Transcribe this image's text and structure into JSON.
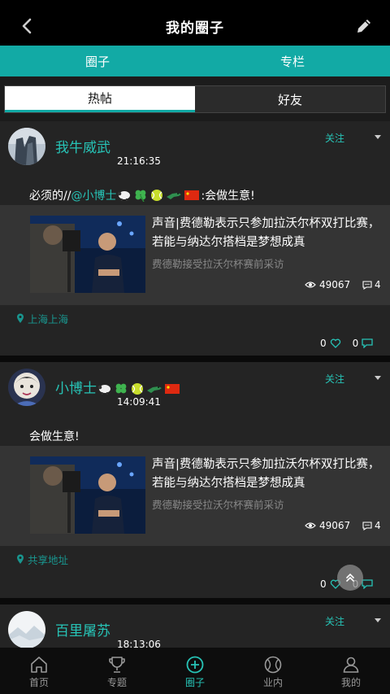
{
  "header": {
    "title": "我的圈子"
  },
  "tabs": [
    {
      "label": "圈子"
    },
    {
      "label": "专栏"
    }
  ],
  "subtabs": [
    {
      "label": "热帖",
      "active": true
    },
    {
      "label": "好友",
      "active": false
    }
  ],
  "colors": {
    "accent": "#12aaa5",
    "accent_text": "#27c3b6",
    "card_bg": "#242424"
  },
  "posts": [
    {
      "author": "我牛威武",
      "time": "21:16:35",
      "follow_label": "关注",
      "text_prefix": "必须的//",
      "mention": "@小博士",
      "text_suffix": ":会做生意!",
      "card": {
        "title": "声音|费德勒表示只参加拉沃尔杯双打比赛，若能与纳达尔搭档是梦想成真",
        "subtitle": "费德勒接受拉沃尔杯赛前采访",
        "views": "49067",
        "comments": "4"
      },
      "location": "上海上海",
      "likes": "0",
      "replies": "0"
    },
    {
      "author": "小博士",
      "time": "14:09:41",
      "follow_label": "关注",
      "text": "会做生意!",
      "card": {
        "title": "声音|费德勒表示只参加拉沃尔杯双打比赛，若能与纳达尔搭档是梦想成真",
        "subtitle": "费德勒接受拉沃尔杯赛前采访",
        "views": "49067",
        "comments": "4"
      },
      "location": "共享地址",
      "likes": "0",
      "replies": "0"
    },
    {
      "author": "百里屠苏",
      "time": "18:13:06",
      "follow_label": "关注"
    }
  ],
  "bottom_nav": [
    {
      "label": "首页",
      "icon": "home-icon"
    },
    {
      "label": "专题",
      "icon": "trophy-icon"
    },
    {
      "label": "圈子",
      "icon": "circle-plus-icon",
      "active": true
    },
    {
      "label": "业内",
      "icon": "tennis-ball-icon"
    },
    {
      "label": "我的",
      "icon": "user-icon"
    }
  ]
}
